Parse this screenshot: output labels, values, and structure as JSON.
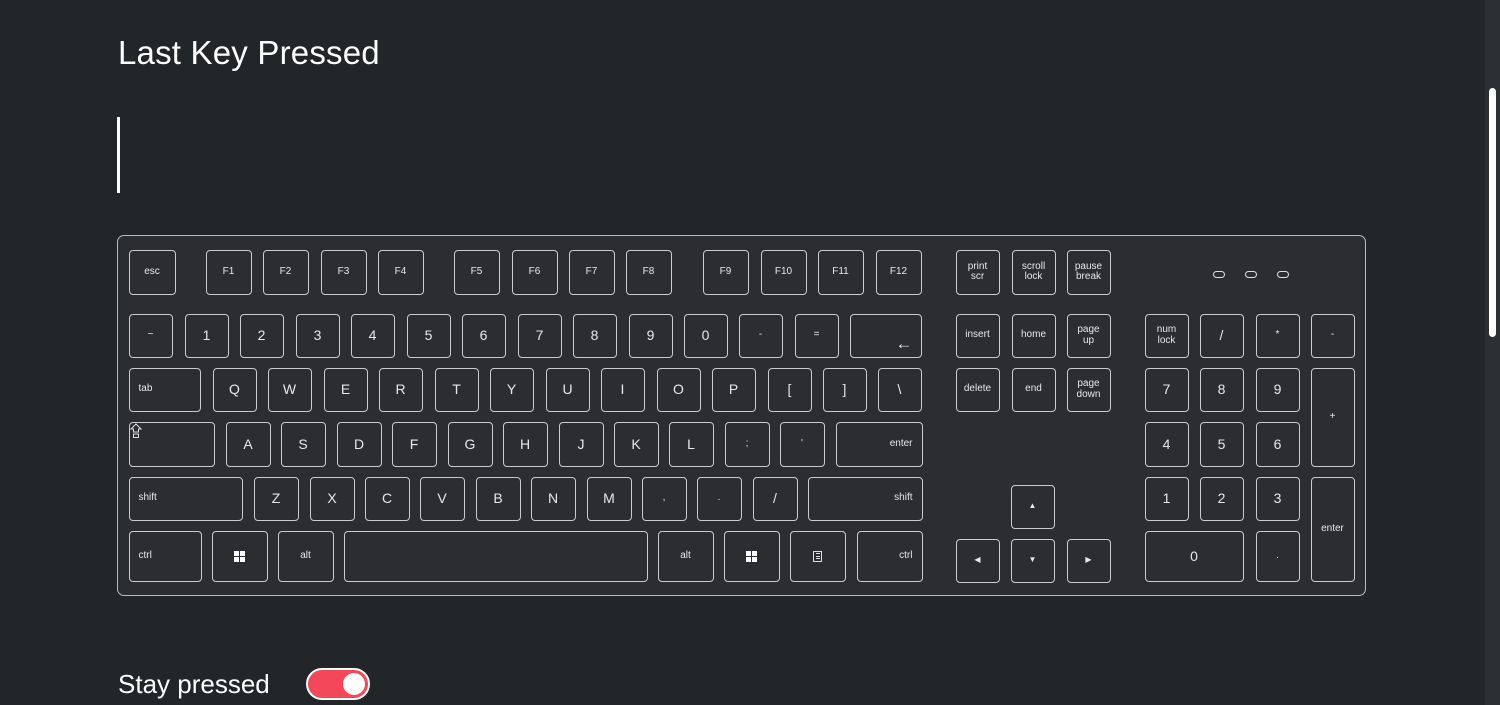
{
  "header": {
    "title": "Last Key Pressed"
  },
  "last_key_display": {
    "value": ""
  },
  "keyboard": {
    "function_row": [
      "esc",
      "F1",
      "F2",
      "F3",
      "F4",
      "F5",
      "F6",
      "F7",
      "F8",
      "F9",
      "F10",
      "F11",
      "F12"
    ],
    "system_keys": [
      "print\nscr",
      "scroll\nlock",
      "pause\nbreak"
    ],
    "number_row": [
      "~",
      "1",
      "2",
      "3",
      "4",
      "5",
      "6",
      "7",
      "8",
      "9",
      "0",
      "-",
      "="
    ],
    "backspace_icon": "←",
    "tab_label": "tab",
    "qwerty_row": [
      "Q",
      "W",
      "E",
      "R",
      "T",
      "Y",
      "U",
      "I",
      "O",
      "P",
      "[",
      "]",
      "\\"
    ],
    "caps_icon": "caps-lock-icon",
    "home_row": [
      "A",
      "S",
      "D",
      "F",
      "G",
      "H",
      "J",
      "K",
      "L",
      ";",
      "'"
    ],
    "enter_label": "enter",
    "shift_label": "shift",
    "bottom_letters": [
      "Z",
      "X",
      "C",
      "V",
      "B",
      "N",
      "M",
      ",",
      ".",
      "/"
    ],
    "ctrl_label": "ctrl",
    "alt_label": "alt",
    "nav_keys_row1": [
      "insert",
      "home",
      "page\nup"
    ],
    "nav_keys_row2": [
      "delete",
      "end",
      "page\ndown"
    ],
    "arrows": {
      "up": "▲",
      "left": "◀",
      "down": "▼",
      "right": "▶"
    },
    "numpad": {
      "row1": [
        "num\nlock",
        "/",
        "*",
        "-"
      ],
      "row2": [
        "7",
        "8",
        "9"
      ],
      "plus": "+",
      "row3": [
        "4",
        "5",
        "6"
      ],
      "row4": [
        "1",
        "2",
        "3"
      ],
      "enter": "enter",
      "zero": "0",
      "dot": "."
    },
    "leds": [
      "num-lock-led",
      "caps-lock-led",
      "scroll-lock-led"
    ]
  },
  "settings": {
    "stay_pressed_label": "Stay pressed",
    "stay_pressed_on": true,
    "toggle_color": "#f4485a"
  }
}
